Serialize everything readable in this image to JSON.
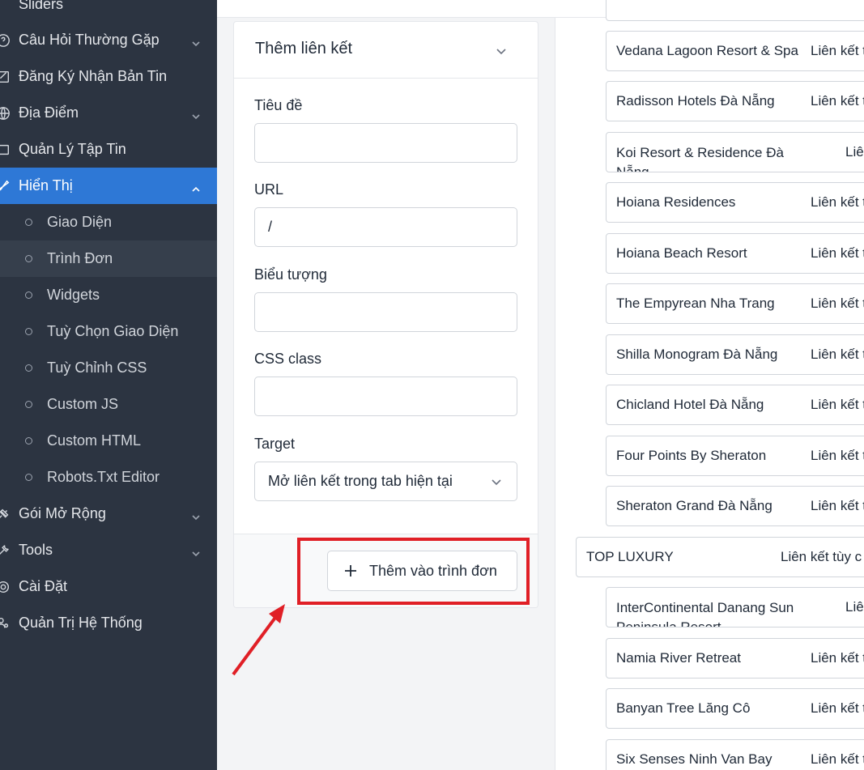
{
  "sidebar": {
    "items": [
      {
        "label": "Sliders"
      },
      {
        "label": "Câu Hỏi Thường Gặp"
      },
      {
        "label": "Đăng Ký Nhận Bản Tin"
      },
      {
        "label": "Địa Điểm"
      },
      {
        "label": "Quản Lý Tập Tin"
      },
      {
        "label": "Hiển Thị"
      },
      {
        "label": "Gói Mở Rộng"
      },
      {
        "label": "Tools"
      },
      {
        "label": "Cài Đặt"
      },
      {
        "label": "Quản Trị Hệ Thống"
      }
    ],
    "subitems": [
      {
        "label": "Giao Diện"
      },
      {
        "label": "Trình Đơn"
      },
      {
        "label": "Widgets"
      },
      {
        "label": "Tuỳ Chọn Giao Diện"
      },
      {
        "label": "Tuỳ Chỉnh CSS"
      },
      {
        "label": "Custom JS"
      },
      {
        "label": "Custom HTML"
      },
      {
        "label": "Robots.Txt Editor"
      }
    ]
  },
  "form": {
    "title": "Thêm liên kết",
    "title_label": "Tiêu đề",
    "title_value": "",
    "url_label": "URL",
    "url_value": "/",
    "icon_label": "Biểu tượng",
    "icon_value": "",
    "css_label": "CSS class",
    "css_value": "",
    "target_label": "Target",
    "target_value": "Mở liên kết trong tab hiện tại",
    "add_button": "Thêm vào trình đơn"
  },
  "menu": {
    "items": [
      {
        "name": "Vedana Lagoon Resort & Spa",
        "type": "Liên kết t"
      },
      {
        "name": "Radisson Hotels Đà Nẵng",
        "type": "Liên kết t"
      },
      {
        "name": "Koi Resort & Residence Đà Nẵng",
        "type": "Liê"
      },
      {
        "name": "Hoiana Residences",
        "type": "Liên kết t"
      },
      {
        "name": "Hoiana Beach Resort",
        "type": "Liên kết t"
      },
      {
        "name": "The Empyrean Nha Trang",
        "type": "Liên kết t"
      },
      {
        "name": "Shilla Monogram Đà Nẵng",
        "type": "Liên kết t"
      },
      {
        "name": "Chicland Hotel Đà Nẵng",
        "type": "Liên kết t"
      },
      {
        "name": "Four Points By Sheraton",
        "type": "Liên kết t"
      },
      {
        "name": "Sheraton Grand Đà Nẵng",
        "type": "Liên kết t"
      },
      {
        "name": "TOP LUXURY",
        "type": "Liên kết tùy c"
      },
      {
        "name": "InterContinental Danang Sun Peninsula Resort",
        "type": "Liê"
      },
      {
        "name": "Namia River Retreat",
        "type": "Liên kết t"
      },
      {
        "name": "Banyan Tree Lăng Cô",
        "type": "Liên kết t"
      },
      {
        "name": "Six Senses Ninh Van Bay",
        "type": "Liên kết t"
      }
    ]
  },
  "colors": {
    "sidebar_bg": "#2c3441",
    "active_bg": "#2e78d6",
    "highlight": "#e01f26"
  },
  "icons": [
    "faq-icon",
    "mail-icon",
    "globe-icon",
    "folder-icon",
    "brush-icon",
    "plugin-icon",
    "tools-icon",
    "gear-icon",
    "users-icon",
    "chevron-down-icon",
    "chevron-up-icon",
    "plus-icon"
  ]
}
